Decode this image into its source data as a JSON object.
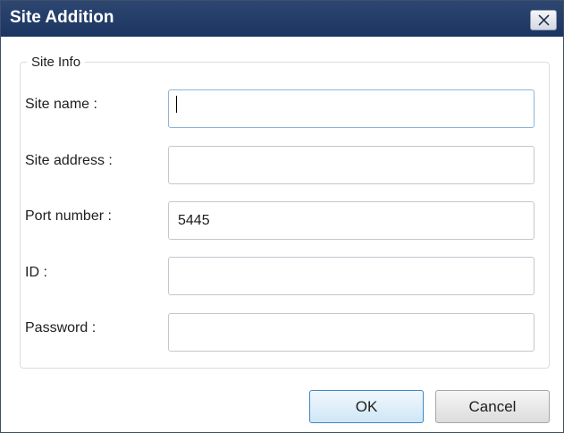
{
  "window": {
    "title": "Site Addition",
    "close_icon": "close-icon"
  },
  "site_info": {
    "legend": "Site Info",
    "fields": [
      {
        "label": "Site name :",
        "value": ""
      },
      {
        "label": "Site address :",
        "value": ""
      },
      {
        "label": "Port number :",
        "value": "5445"
      },
      {
        "label": "ID :",
        "value": ""
      },
      {
        "label": "Password :",
        "value": ""
      }
    ]
  },
  "buttons": {
    "ok": "OK",
    "cancel": "Cancel"
  },
  "colors": {
    "titlebar": "#1c3461",
    "ok_border": "#3c89c9",
    "focused_field_border": "#8db4d8"
  }
}
